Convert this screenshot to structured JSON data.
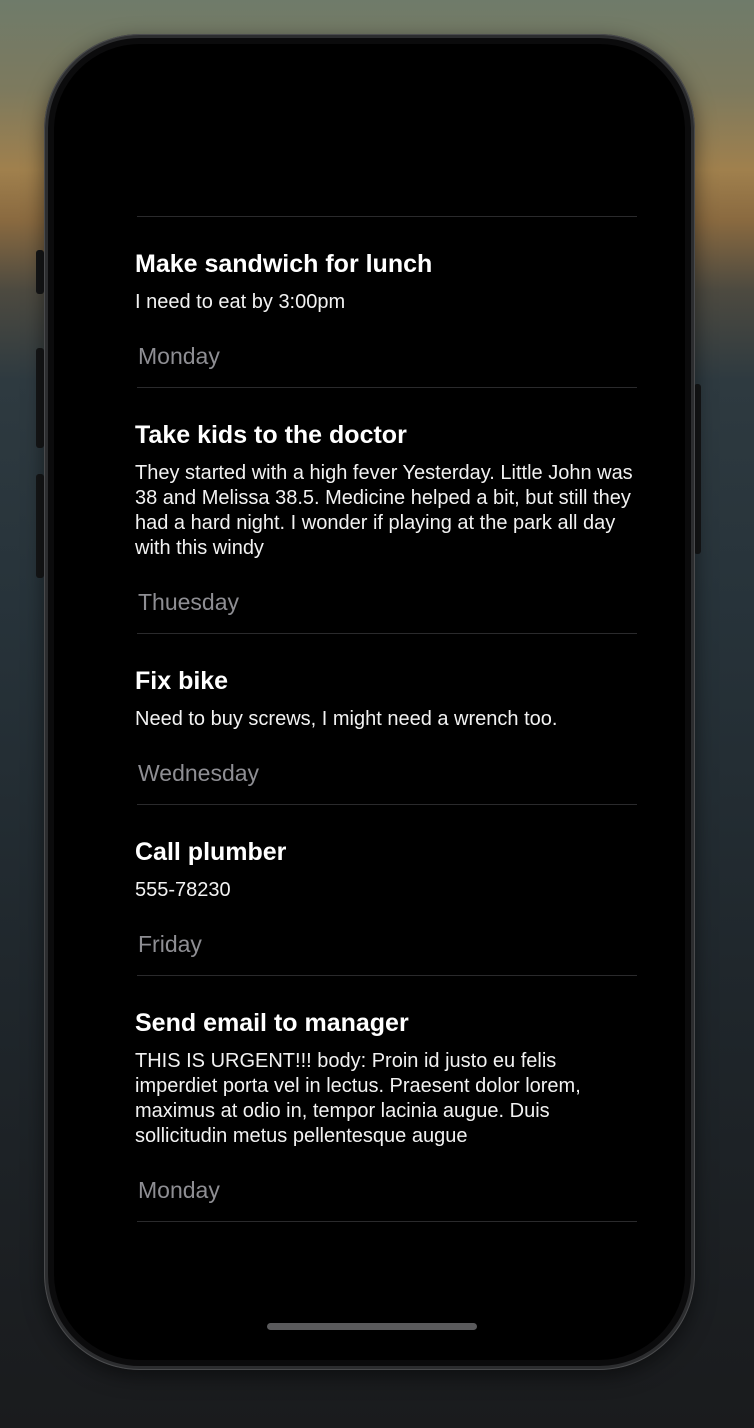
{
  "todos": [
    {
      "title": "Make sandwich for lunch",
      "body": "I need to eat by 3:00pm",
      "day": "Monday"
    },
    {
      "title": "Take kids to the doctor",
      "body": "They started with a high fever Yesterday. Little John was 38 and Melissa 38.5. Medicine helped a bit, but still they had a hard night. I wonder if playing at the park all day with this windy",
      "day": "Thuesday"
    },
    {
      "title": "Fix bike",
      "body": "Need to buy screws, I might need a wrench too.",
      "day": "Wednesday"
    },
    {
      "title": "Call plumber",
      "body": "555-78230",
      "day": "Friday"
    },
    {
      "title": "Send email to manager",
      "body": "THIS IS URGENT!!! body: Proin id justo eu felis imperdiet porta vel in lectus. Praesent dolor lorem, maximus at odio in, tempor lacinia augue. Duis sollicitudin metus pellentesque augue",
      "day": "Monday"
    }
  ]
}
